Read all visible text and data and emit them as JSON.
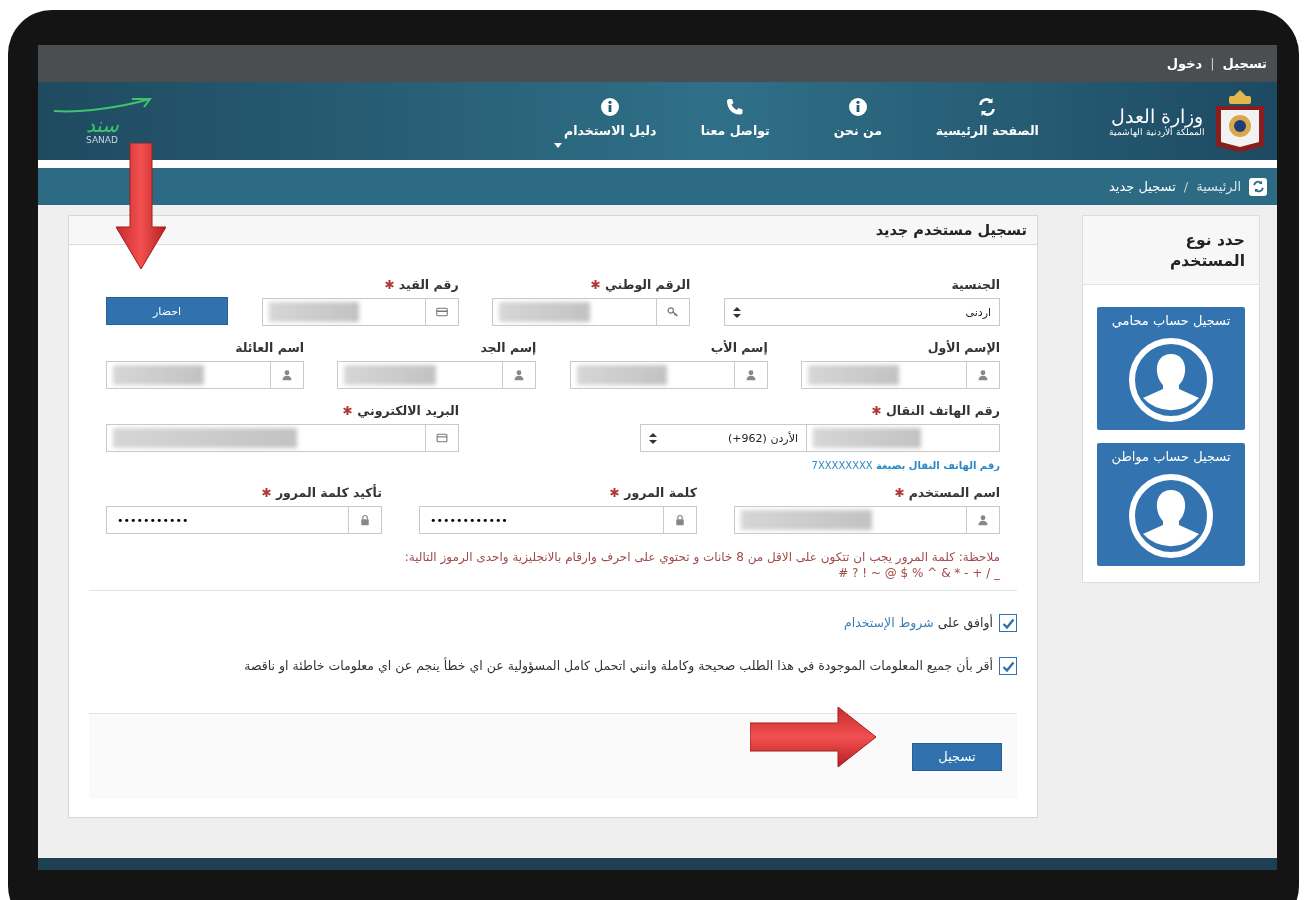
{
  "top_bar": {
    "links": [
      {
        "label": "تسجيل"
      },
      {
        "label": "دخول"
      }
    ],
    "separator": "|"
  },
  "header": {
    "ministry": {
      "title": "وزارة العدل",
      "subtitle": "المملكة الأردنية الهاشمية"
    },
    "nav": [
      {
        "label": "الصفحة الرئيسية",
        "dropdown": false
      },
      {
        "label": "من نحن",
        "dropdown": false
      },
      {
        "label": "تواصل معنا",
        "dropdown": false
      },
      {
        "label": "دليل الاستخدام",
        "dropdown": true
      }
    ],
    "brand": {
      "script": "سند",
      "name": "SANAD"
    }
  },
  "breadcrumb": {
    "items": [
      "الرئيسية",
      "تسجيل جديد"
    ],
    "separator": "/"
  },
  "form": {
    "title": "تسجيل مستخدم جديد",
    "sections": [
      {
        "fields": [
          {
            "kind": "select",
            "label": "الجنسية",
            "required": false,
            "value": "اردنى"
          },
          {
            "kind": "national-id",
            "label": "الرقم الوطني",
            "required": true,
            "redacted": true
          },
          {
            "kind": "registry",
            "label": "رقم القيد",
            "required": true,
            "redacted": true
          },
          {
            "kind": "button",
            "label": "احضار"
          }
        ]
      },
      {
        "fields": [
          {
            "kind": "name",
            "label": "الإسم الأول",
            "required": false,
            "redacted": true
          },
          {
            "kind": "name",
            "label": "إسم الأب",
            "required": false,
            "redacted": true
          },
          {
            "kind": "name",
            "label": "إسم الجد",
            "required": false,
            "redacted": true
          },
          {
            "kind": "name",
            "label": "اسم العائلة",
            "required": false,
            "redacted": true
          }
        ]
      },
      {
        "fields": [
          {
            "kind": "phone",
            "label": "رقم الهاتف النقال",
            "required": true,
            "country": "الأردن (962+)",
            "redacted": true,
            "hint": "**رقم الهاتف النقال بصيغة** 7XXXXXXXX"
          },
          {
            "kind": "email",
            "label": "البريد الالكتروني",
            "required": true,
            "redacted": true
          }
        ]
      },
      {
        "fields": [
          {
            "kind": "username",
            "label": "اسم المستخدم",
            "required": true,
            "redacted": true
          },
          {
            "kind": "password",
            "label": "كلمة المرور",
            "required": true,
            "value": "••••••••••••"
          },
          {
            "kind": "password",
            "label": "تأكيد كلمة المرور",
            "required": true,
            "value": "•••••••••••"
          }
        ]
      }
    ],
    "note": "ملاحظة: كلمة المرور يجب ان تتكون على الاقل من 8 خانات و تحتوي على احرف وارقام بالانجليزية واحدى الرموز التالية:",
    "symbols": "# ? ! ~ @ $ % ^ & * - + / _",
    "agreements": [
      {
        "text": "أوافق على",
        "link": "شروط الإستخدام",
        "checked": true
      },
      {
        "text": "أقر بأن جميع المعلومات الموجودة في هذا الطلب صحيحة وكاملة وانني اتحمل كامل المسؤولية عن اي خطأ ينجم عن اي معلومات خاطئة او ناقصة",
        "checked": true
      }
    ],
    "submit": "تسجيل"
  },
  "sidebar": {
    "title": "حدد نوع المستخدم",
    "cards": [
      {
        "label": "تسجيل حساب محامي"
      },
      {
        "label": "تسجيل حساب مواطن"
      }
    ]
  }
}
